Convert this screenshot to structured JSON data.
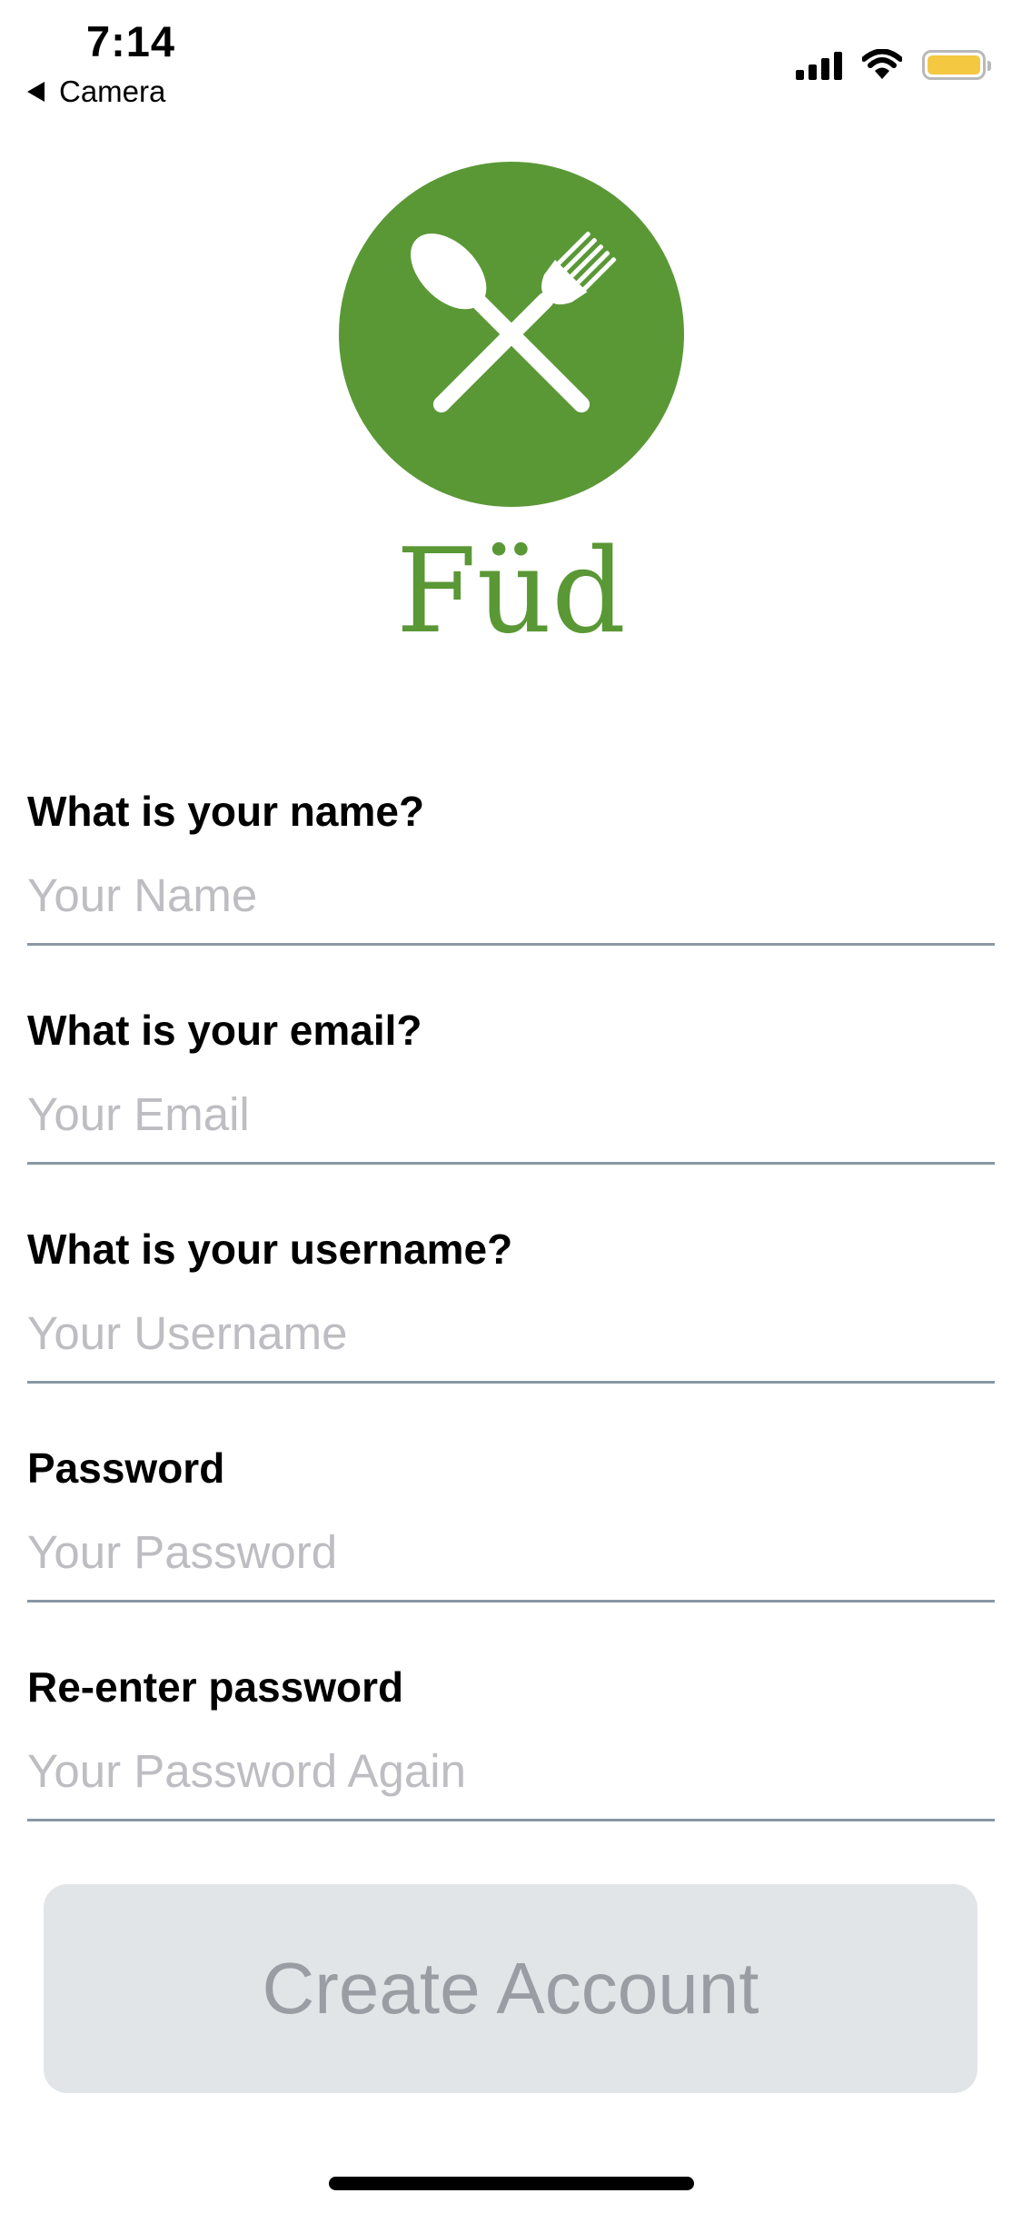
{
  "status_bar": {
    "time": "7:14",
    "back_app": "Camera",
    "battery_color": "#f5c842"
  },
  "logo": {
    "icon": "spoon-fork-icon",
    "brand_name": "Füd",
    "brand_color": "#5a9836"
  },
  "form": {
    "fields": [
      {
        "label": "What is your name?",
        "placeholder": "Your Name",
        "value": ""
      },
      {
        "label": "What is your email?",
        "placeholder": "Your Email",
        "value": ""
      },
      {
        "label": "What is your username?",
        "placeholder": "Your Username",
        "value": ""
      },
      {
        "label": "Password",
        "placeholder": "Your Password",
        "value": ""
      },
      {
        "label": "Re-enter password",
        "placeholder": "Your Password Again",
        "value": ""
      }
    ],
    "submit_label": "Create Account"
  }
}
